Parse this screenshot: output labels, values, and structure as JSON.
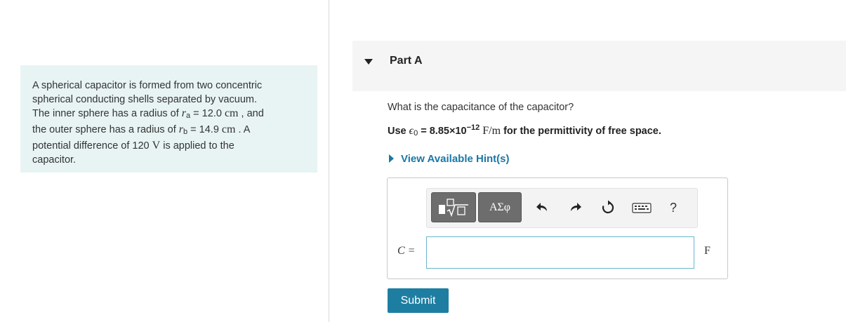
{
  "problem": {
    "t1": "A spherical capacitor is formed from two concentric",
    "t2": "spherical conducting shells separated by vacuum.",
    "t3": "The inner sphere has a radius of",
    "ra_sym": "r",
    "ra_sub": "a",
    "ra_eq": " = 12.0 ",
    "ra_unit": "cm",
    "ra_after": " , and",
    "t4": "the outer sphere has a radius of",
    "rb_sym": "r",
    "rb_sub": "b",
    "rb_eq": " = 14.9 ",
    "rb_unit": "cm",
    "rb_after": " . A",
    "t5": "potential difference of 120 ",
    "v_unit": "V",
    "t5_after": " is applied to the",
    "t6": "capacitor."
  },
  "part": {
    "title": "Part A"
  },
  "question": "What is the capacitance of the capacitor?",
  "use_line": {
    "prefix": "Use ",
    "eps": "ϵ",
    "eps_sub": "0",
    "eq": " = 8.85×10",
    "exp": "−12",
    "unit": "F/m",
    "suffix": " for the permittivity of free space."
  },
  "hint_label": "View Available Hint(s)",
  "toolbar": {
    "templates_icon": "templates-icon",
    "greek_label": "ΑΣφ",
    "undo_icon": "undo-icon",
    "redo_icon": "redo-icon",
    "reset_icon": "reset-icon",
    "keyboard_icon": "keyboard-icon",
    "help_label": "?"
  },
  "answer": {
    "label": "C =",
    "value": "",
    "unit": "F"
  },
  "submit_label": "Submit",
  "colors": {
    "link": "#1a78a6",
    "submit": "#1d7ea2",
    "problem_bg": "#e8f4f4",
    "input_border": "#6ab5cf"
  }
}
